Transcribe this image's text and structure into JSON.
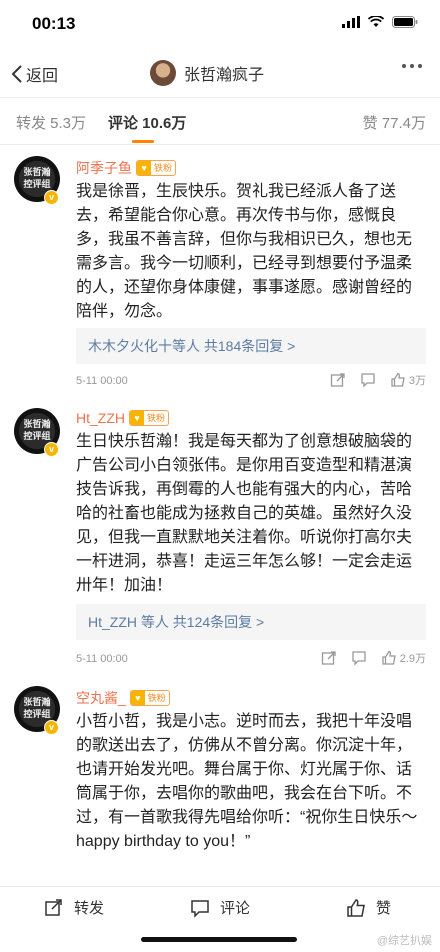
{
  "status": {
    "time": "00:13"
  },
  "nav": {
    "back_label": "返回",
    "title": "张哲瀚疯子"
  },
  "tabs": {
    "repost": "转发 5.3万",
    "comment": "评论 10.6万",
    "like": "赞 77.4万"
  },
  "avatar_text": "张哲瀚\n控评组",
  "colors": {
    "accent": "#ff8200",
    "username": "#eb7350",
    "link": "#5d7ca3"
  },
  "comments": [
    {
      "username": "阿季子鱼",
      "badge": "铁粉",
      "text": "我是徐晋，生辰快乐。贺礼我已经派人备了送去，希望能合你心意。再次传书与你，感慨良多，我虽不善言辞，但你与我相识已久，想也无需多言。我今一切顺利，已经寻到想要付予温柔的人，还望你身体康健，事事遂愿。感谢曾经的陪伴，勿念。",
      "reply_users": "木木夕火化十等人",
      "reply_count": "共184条回复 >",
      "time": "5-11 00:00",
      "likes": "3万"
    },
    {
      "username": "Ht_ZZH",
      "badge": "铁粉",
      "text": "生日快乐哲瀚！我是每天都为了创意想破脑袋的广告公司小白领张伟。是你用百变造型和精湛演技告诉我，再倒霉的人也能有强大的内心，苦哈哈的社畜也能成为拯救自己的英雄。虽然好久没见，但我一直默默地关注着你。听说你打高尔夫一杆进洞，恭喜！走运三年怎么够！一定会走运卅年！加油！",
      "reply_users": "Ht_ZZH 等人",
      "reply_count": "共124条回复 >",
      "time": "5-11 00:00",
      "likes": "2.9万"
    },
    {
      "username": "空丸酱_",
      "badge": "铁粉",
      "text": "小哲小哲，我是小志。逆时而去，我把十年没唱的歌送出去了，仿佛从不曾分离。你沉淀十年，也请开始发光吧。舞台属于你、灯光属于你、话筒属于你，去唱你的歌曲吧，我会在台下听。不过，有一首歌我得先唱给你听：“祝你生日快乐～happy birthday to you！”"
    }
  ],
  "bottom_bar": {
    "repost": "转发",
    "comment": "评论",
    "like": "赞"
  },
  "watermark": "@综艺扒娱"
}
